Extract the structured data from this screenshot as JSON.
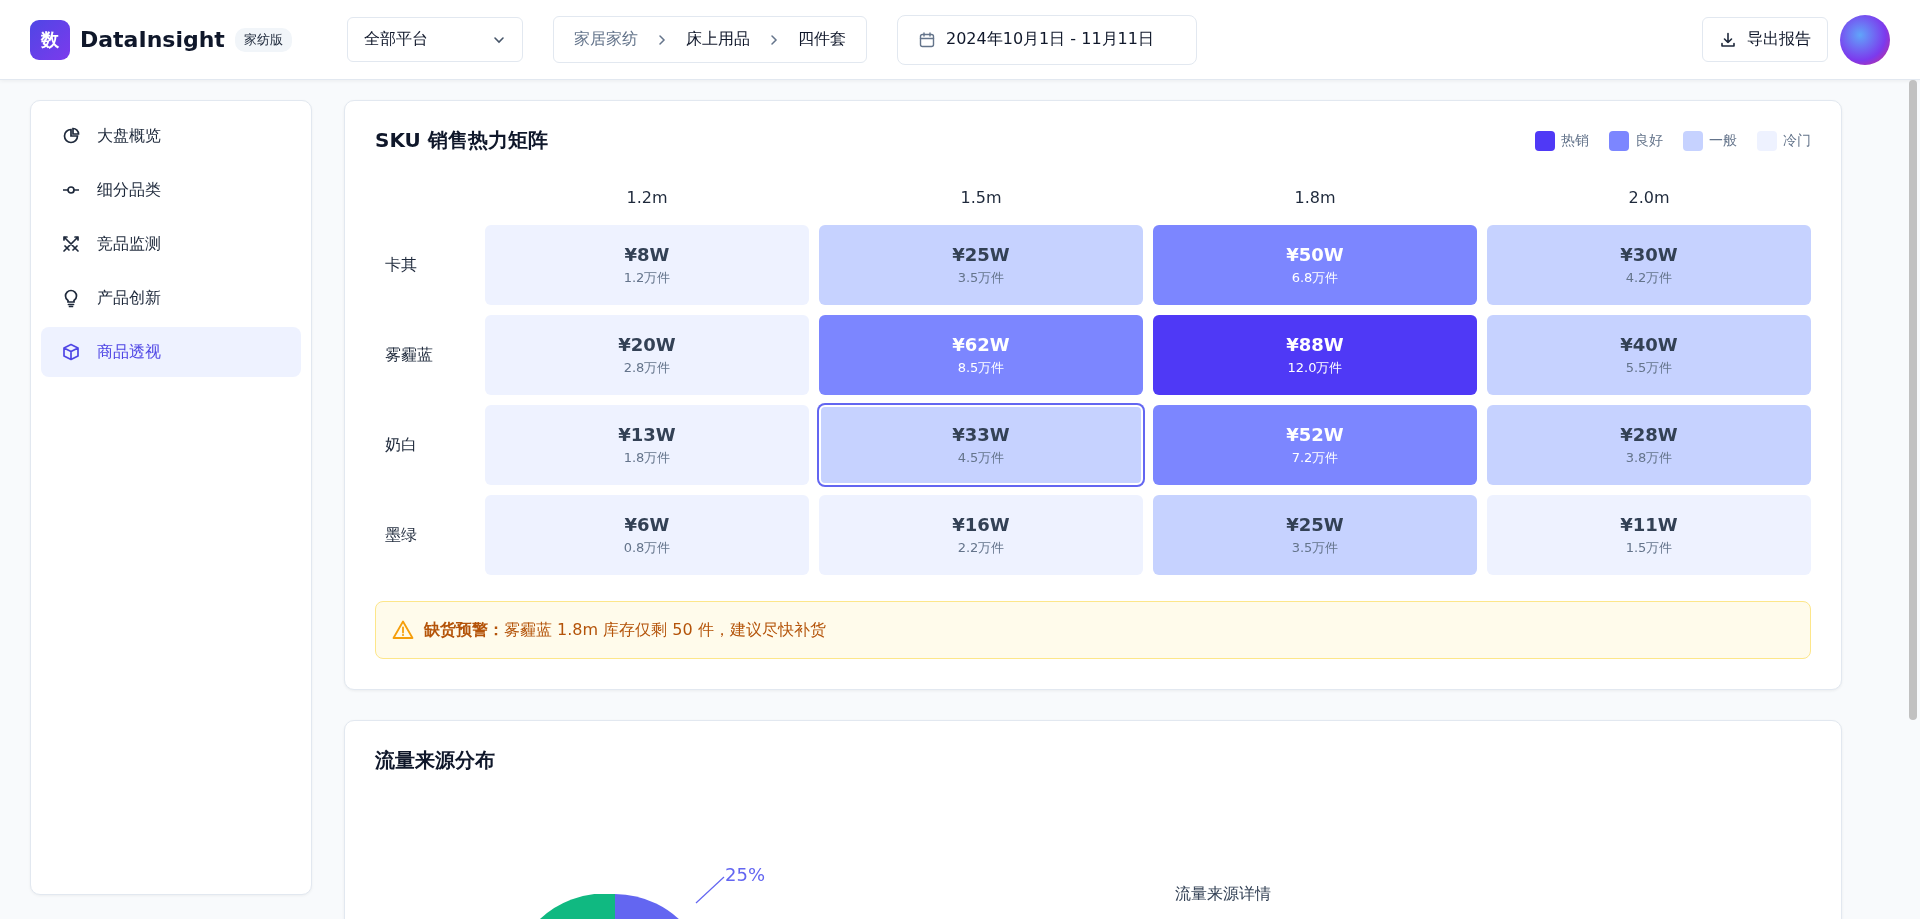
{
  "header": {
    "logo_mark": "数",
    "brand": "DataInsight",
    "edition": "家纺版",
    "platform_select": {
      "value": "全部平台"
    },
    "breadcrumb": [
      "家居家纺",
      "床上用品",
      "四件套"
    ],
    "date_range": "2024年10月1日 - 11月11日",
    "export_button": "导出报告"
  },
  "sidebar": {
    "items": [
      {
        "label": "大盘概览",
        "kind": "pie",
        "selected": false
      },
      {
        "label": "细分品类",
        "kind": "commit",
        "selected": false
      },
      {
        "label": "竞品监测",
        "kind": "swords",
        "selected": false
      },
      {
        "label": "产品创新",
        "kind": "bulb",
        "selected": false
      },
      {
        "label": "商品透视",
        "kind": "box",
        "selected": true
      }
    ]
  },
  "heatmap": {
    "title": "SKU 销售热力矩阵",
    "legend": [
      {
        "label": "热销",
        "color": "#4f39f6"
      },
      {
        "label": "良好",
        "color": "#7c86ff"
      },
      {
        "label": "一般",
        "color": "#c6d2ff"
      },
      {
        "label": "冷门",
        "color": "#eef2ff"
      }
    ],
    "columns": [
      "1.2m",
      "1.5m",
      "1.8m",
      "2.0m"
    ],
    "rows": [
      {
        "label": "卡其",
        "cells": [
          {
            "value": "¥8W",
            "units": "1.2万件",
            "kind": "cold",
            "selected": false
          },
          {
            "value": "¥25W",
            "units": "3.5万件",
            "kind": "normal",
            "selected": false
          },
          {
            "value": "¥50W",
            "units": "6.8万件",
            "kind": "good",
            "selected": false
          },
          {
            "value": "¥30W",
            "units": "4.2万件",
            "kind": "normal",
            "selected": false
          }
        ]
      },
      {
        "label": "雾霾蓝",
        "cells": [
          {
            "value": "¥20W",
            "units": "2.8万件",
            "kind": "cold",
            "selected": false
          },
          {
            "value": "¥62W",
            "units": "8.5万件",
            "kind": "good",
            "selected": false
          },
          {
            "value": "¥88W",
            "units": "12.0万件",
            "kind": "hot",
            "selected": false
          },
          {
            "value": "¥40W",
            "units": "5.5万件",
            "kind": "normal",
            "selected": false
          }
        ]
      },
      {
        "label": "奶白",
        "cells": [
          {
            "value": "¥13W",
            "units": "1.8万件",
            "kind": "cold",
            "selected": false
          },
          {
            "value": "¥33W",
            "units": "4.5万件",
            "kind": "normal",
            "selected": true
          },
          {
            "value": "¥52W",
            "units": "7.2万件",
            "kind": "good",
            "selected": false
          },
          {
            "value": "¥28W",
            "units": "3.8万件",
            "kind": "normal",
            "selected": false
          }
        ]
      },
      {
        "label": "墨绿",
        "cells": [
          {
            "value": "¥6W",
            "units": "0.8万件",
            "kind": "cold",
            "selected": false
          },
          {
            "value": "¥16W",
            "units": "2.2万件",
            "kind": "cold",
            "selected": false
          },
          {
            "value": "¥25W",
            "units": "3.5万件",
            "kind": "normal",
            "selected": false
          },
          {
            "value": "¥11W",
            "units": "1.5万件",
            "kind": "cold",
            "selected": false
          }
        ]
      }
    ],
    "alert": {
      "text": "**缺货预警：**雾霾蓝 1.8m 库存仅剩 50 件，建议尽快补货"
    }
  },
  "traffic": {
    "title": "流量来源分布",
    "pie_label": "25%",
    "detail_title": "流量来源详情"
  }
}
